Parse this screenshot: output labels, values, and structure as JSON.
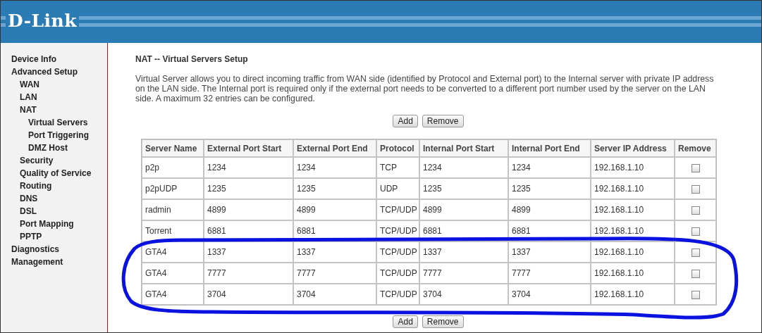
{
  "header": {
    "logo": "D-Link"
  },
  "sidebar": {
    "items": [
      {
        "label": "Device Info"
      },
      {
        "label": "Advanced Setup",
        "children": [
          {
            "label": "WAN"
          },
          {
            "label": "LAN"
          },
          {
            "label": "NAT",
            "children": [
              {
                "label": "Virtual Servers"
              },
              {
                "label": "Port Triggering"
              },
              {
                "label": "DMZ Host"
              }
            ]
          },
          {
            "label": "Security"
          },
          {
            "label": "Quality of Service"
          },
          {
            "label": "Routing"
          },
          {
            "label": "DNS"
          },
          {
            "label": "DSL"
          },
          {
            "label": "Port Mapping"
          },
          {
            "label": "PPTP"
          }
        ]
      },
      {
        "label": "Diagnostics"
      },
      {
        "label": "Management"
      }
    ]
  },
  "page": {
    "title": "NAT -- Virtual Servers Setup",
    "description": "Virtual Server allows you to direct incoming traffic from WAN side (identified by Protocol and External port) to the Internal server with private IP address on the LAN side. The Internal port is required only if the external port needs to be converted to a different port number used by the server on the LAN side. A maximum 32 entries can be configured.",
    "top_buttons": [
      "Add",
      "Remove"
    ],
    "table": {
      "columns": [
        "Server Name",
        "External Port Start",
        "External Port End",
        "Protocol",
        "Internal Port Start",
        "Internal Port End",
        "Server IP Address",
        "Remove"
      ],
      "rows": [
        {
          "cells": [
            "p2p",
            "1234",
            "1234",
            "TCP",
            "1234",
            "1234",
            "192.168.1.10"
          ],
          "checked": false
        },
        {
          "cells": [
            "p2pUDP",
            "1235",
            "1235",
            "UDP",
            "1235",
            "1235",
            "192.168.1.10"
          ],
          "checked": false
        },
        {
          "cells": [
            "radmin",
            "4899",
            "4899",
            "TCP/UDP",
            "4899",
            "4899",
            "192.168.1.10"
          ],
          "checked": false
        },
        {
          "cells": [
            "Torrent",
            "6881",
            "6881",
            "TCP/UDP",
            "6881",
            "6881",
            "192.168.1.10"
          ],
          "checked": false
        },
        {
          "cells": [
            "GTA4",
            "1337",
            "1337",
            "TCP/UDP",
            "1337",
            "1337",
            "192.168.1.10"
          ],
          "checked": false
        },
        {
          "cells": [
            "GTA4",
            "7777",
            "7777",
            "TCP/UDP",
            "7777",
            "7777",
            "192.168.1.10"
          ],
          "checked": false
        },
        {
          "cells": [
            "GTA4",
            "3704",
            "3704",
            "TCP/UDP",
            "3704",
            "3704",
            "192.168.1.10"
          ],
          "checked": false
        }
      ]
    },
    "bottom_buttons": [
      "Add",
      "Remove"
    ]
  },
  "annotation": {
    "kind": "loop"
  }
}
